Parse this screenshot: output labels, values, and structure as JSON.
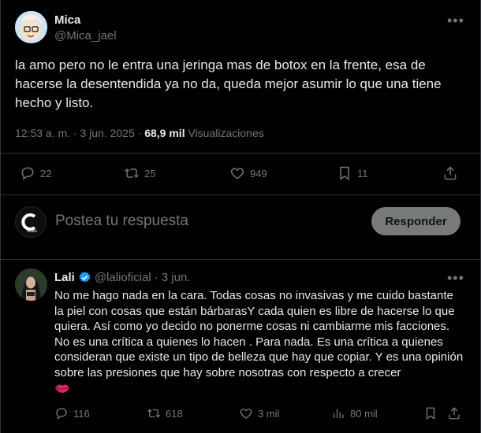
{
  "post": {
    "author_name": "Mica",
    "author_handle": "@Mica_jael",
    "text": "la amo pero no le entra una jeringa mas de botox en la frente, esa de hacerse la desentendida ya no da, queda mejor asumir lo que una tiene hecho y listo.",
    "timestamp": "12:53 a. m. · 3 jun. 2025 · ",
    "views_count": "68,9 mil",
    "views_label": "Visualizaciones",
    "actions": {
      "replies": "22",
      "reposts": "25",
      "likes": "949",
      "bookmarks": "11"
    }
  },
  "composer": {
    "placeholder": "Postea tu respuesta",
    "reply_button": "Responder"
  },
  "reply": {
    "author_name": "Lali",
    "author_handle": "@lalioficial",
    "separator": "·",
    "date": "3 jun.",
    "text": "No me hago nada en la cara. Todas cosas no invasivas y me cuido bastante la piel con cosas que están bárbarasY cada quien es libre de hacerse lo que quiera. Así como yo decido no ponerme cosas ni cambiarme mis facciones. No es una crítica a quienes lo hacen . Para nada. Es una crítica a quienes consideran que existe un tipo de belleza que hay que copiar. Y es una opinión sobre las presiones que hay sobre nosotras con respecto a crecer",
    "actions": {
      "replies": "116",
      "reposts": "618",
      "likes": "3 mil",
      "views": "80 mil"
    }
  },
  "colors": {
    "background": "#000000",
    "text": "#e7e9ea",
    "secondary": "#71767b",
    "divider": "#2f3336",
    "verified": "#1d9bf0",
    "button_bg": "#787a7a"
  },
  "icons": [
    "more-icon",
    "reply-icon",
    "repost-icon",
    "like-icon",
    "bookmark-icon",
    "share-icon",
    "views-icon",
    "verified-icon",
    "lips-icon"
  ]
}
